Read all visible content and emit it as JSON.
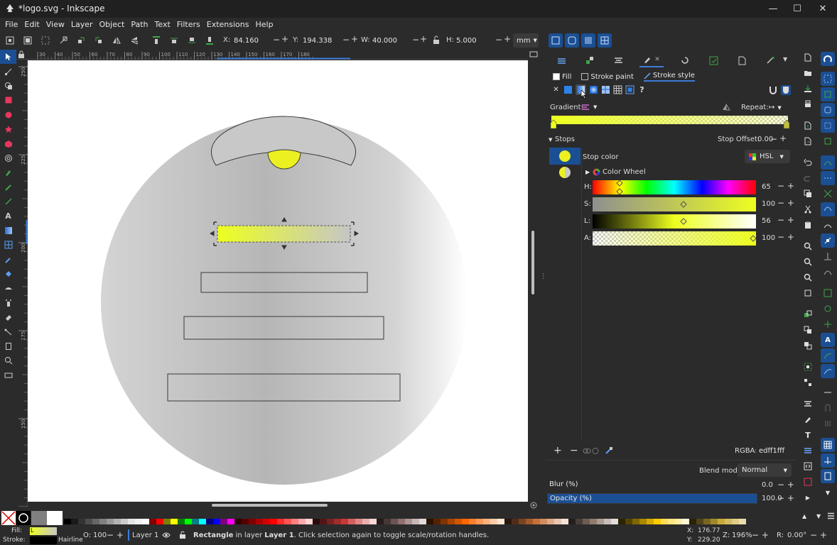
{
  "window": {
    "title": "*logo.svg - Inkscape",
    "minimize": "—",
    "maximize": "☐",
    "close": "✕"
  },
  "menu": [
    "File",
    "Edit",
    "View",
    "Layer",
    "Object",
    "Path",
    "Text",
    "Filters",
    "Extensions",
    "Help"
  ],
  "toolbar": {
    "x_label": "X:",
    "x_value": "84.160",
    "y_label": "Y:",
    "y_value": "194.338",
    "w_label": "W:",
    "w_value": "40.000",
    "h_label": "H:",
    "h_value": "5.000",
    "minus": "−",
    "plus": "+",
    "unit": "mm"
  },
  "ruler": {
    "top_ticks": [
      "30",
      "40",
      "50",
      "60",
      "70",
      "80",
      "90",
      "100",
      "110",
      "120",
      "130",
      "140",
      "150",
      "160",
      "170",
      "180"
    ],
    "left_ticks": [
      "250",
      "225",
      "200",
      "175",
      "150",
      "125"
    ]
  },
  "fill_stroke": {
    "tabs": [
      "Fill",
      "Stroke paint",
      "Stroke style"
    ],
    "gradient_label": "Gradient:",
    "repeat_label": "Repeat:",
    "stops_label": "Stops",
    "stop_offset_label": "Stop Offset:",
    "stop_offset_value": "0.00",
    "stop_color_label": "Stop color",
    "color_mode": "HSL",
    "color_wheel_label": "Color Wheel",
    "sliders": [
      {
        "label": "H:",
        "value": "65"
      },
      {
        "label": "S:",
        "value": "100"
      },
      {
        "label": "L:",
        "value": "56"
      },
      {
        "label": "A:",
        "value": "100"
      }
    ],
    "rgba_label": "RGBA:",
    "rgba_value": "edff1fff",
    "blend_mode_label": "Blend mode:",
    "blend_mode_value": "Normal",
    "blur_label": "Blur (%)",
    "blur_value": "0.0",
    "opacity_label": "Opacity (%)",
    "opacity_value": "100.0",
    "opacity_level": 1.0,
    "help_glyph": "?"
  },
  "status": {
    "fill_label": "Fill:",
    "fill_indicator": "L",
    "stroke_label": "Stroke:",
    "stroke_width": "Hairline",
    "opacity_label": "O:",
    "opacity_value": "100",
    "layer_name": "Layer 1",
    "message_bold": "Rectangle",
    "message_prefix": " in layer ",
    "message_layer": "Layer 1",
    "message_suffix": ". Click selection again to toggle scale/rotation handles.",
    "cursor_x_label": "X:",
    "cursor_x": "176.77",
    "cursor_y_label": "Y:",
    "cursor_y": "229.20",
    "zoom_label": "Z:",
    "zoom_value": "196%",
    "rotation_label": "R:",
    "rotation_value": "0.00°"
  },
  "colors": {
    "accent": "#1b4f94",
    "selected_stop": "#ecf020",
    "canvas": "#ffffff"
  },
  "palette_colors": [
    "#000000",
    "#1a1a1a",
    "#333333",
    "#4d4d4d",
    "#666666",
    "#808080",
    "#999999",
    "#b3b3b3",
    "#cccccc",
    "#e6e6e6",
    "#f2f2f2",
    "#ffffff",
    "#800000",
    "#ff0000",
    "#808000",
    "#ffff00",
    "#008000",
    "#00ff00",
    "#008080",
    "#00ffff",
    "#000080",
    "#0000ff",
    "#800080",
    "#ff00ff",
    "#2b0000",
    "#550000",
    "#800000",
    "#aa0000",
    "#d40000",
    "#ff0000",
    "#ff2a2a",
    "#ff5555",
    "#ff8080",
    "#ffaaaa",
    "#ffd5d5",
    "#280b0b",
    "#501616",
    "#782121",
    "#a02c2c",
    "#c83737",
    "#d35f5f",
    "#de8787",
    "#e9afaf",
    "#f4d7d7",
    "#241c1c",
    "#483737",
    "#6c5353",
    "#916f6f",
    "#ac9393",
    "#c8b7b7",
    "#e3dbdb",
    "#2b1100",
    "#552200",
    "#803300",
    "#aa4400",
    "#d45500",
    "#ff6600",
    "#ff7f2a",
    "#ff9955",
    "#ffb380",
    "#ffccaa",
    "#ffe6d5",
    "#28170b",
    "#502d16",
    "#784421",
    "#a05a2c",
    "#c87137",
    "#d38d5f",
    "#deaa87",
    "#e9c6af",
    "#f4e3d7",
    "#241f1c",
    "#483e37",
    "#6c5d53",
    "#917c6f",
    "#ac9d93",
    "#c8beb7",
    "#e3dedb",
    "#2b2200",
    "#554400",
    "#806600",
    "#aa8800",
    "#d4aa00",
    "#ffcc00",
    "#ffdd55",
    "#ffe680",
    "#ffeeaa",
    "#fff6d5",
    "#28220b",
    "#504416",
    "#786721",
    "#a0892c",
    "#c8ab37",
    "#d3bc5f",
    "#decd87",
    "#e9ddaf"
  ]
}
